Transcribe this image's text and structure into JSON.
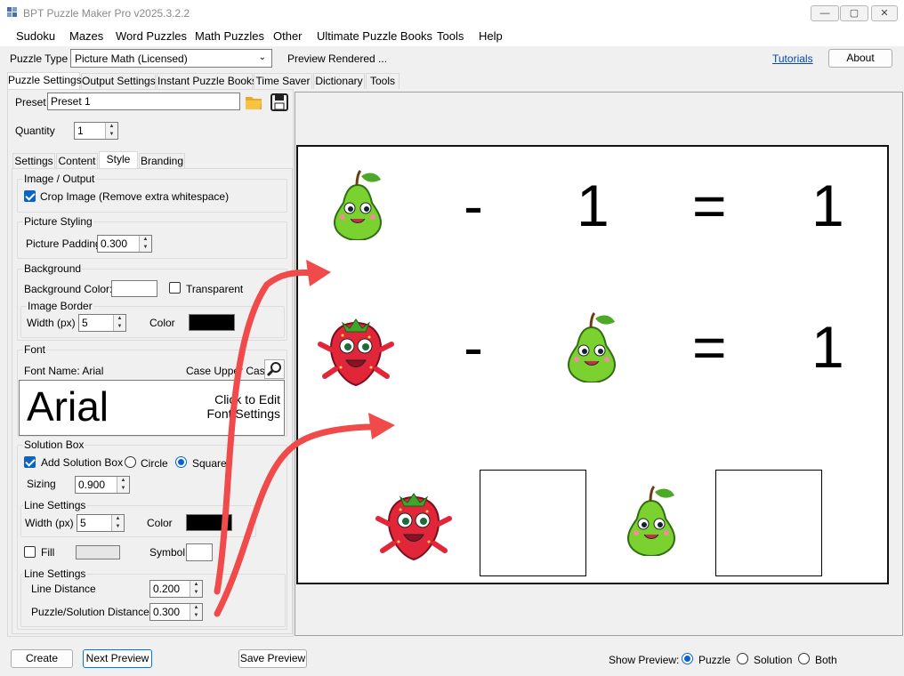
{
  "window": {
    "title": "BPT Puzzle Maker Pro v2025.3.2.2",
    "controls": [
      "—",
      "▢",
      "✕"
    ]
  },
  "menu": [
    "Sudoku",
    "Mazes",
    "Word Puzzles",
    "Math Puzzles",
    "Other",
    "Ultimate Puzzle Books",
    "Tools",
    "Help"
  ],
  "toolbar": {
    "puzzle_type_label": "Puzzle Type",
    "puzzle_type_value": "Picture Math (Licensed)",
    "status": "Preview Rendered ...",
    "tutorials_link": "Tutorials",
    "about_button": "About"
  },
  "main_tabs": [
    "Puzzle Settings",
    "Output Settings",
    "Instant Puzzle Books",
    "Time Saver",
    "Dictionary",
    "Tools"
  ],
  "settings": {
    "preset_label": "Preset",
    "preset_value": "Preset 1",
    "quantity_label": "Quantity",
    "quantity_value": "1",
    "sub_tabs": [
      "Settings",
      "Content",
      "Style",
      "Branding"
    ],
    "image_output": {
      "title": "Image / Output",
      "crop_label": "Crop Image (Remove extra whitespace)"
    },
    "picture_styling": {
      "title": "Picture Styling",
      "padding_label": "Picture Padding",
      "padding_value": "0.300"
    },
    "background": {
      "title": "Background",
      "color_label": "Background Color:",
      "transparent_label": "Transparent",
      "border_title": "Image Border",
      "width_label": "Width (px)",
      "width_value": "5",
      "color_label2": "Color",
      "border_color": "#000000"
    },
    "font": {
      "title": "Font",
      "name_label": "Font Name: Arial",
      "case_label": "Case Upper Case",
      "sample": "Arial",
      "edit_hint_1": "Click to Edit",
      "edit_hint_2": "Font Settings"
    },
    "solution_box": {
      "title": "Solution Box",
      "add_label": "Add Solution Box",
      "circle_label": "Circle",
      "square_label": "Square",
      "sizing_label": "Sizing",
      "sizing_value": "0.900"
    },
    "line_settings": {
      "title": "Line Settings",
      "width_label": "Width (px)",
      "width_value": "5",
      "color_label": "Color",
      "fill_label": "Fill",
      "symbol_label": "Symbol",
      "line_color": "#000000"
    },
    "line_settings2": {
      "title": "Line Settings",
      "distance_label": "Line Distance",
      "distance_value": "0.200",
      "ps_distance_label": "Puzzle/Solution Distance",
      "ps_distance_value": "0.300"
    }
  },
  "preview": {
    "rows": [
      {
        "items": [
          "pear-icon",
          "-",
          "1",
          "=",
          "1"
        ]
      },
      {
        "items": [
          "strawberry-icon",
          "-",
          "pear-icon",
          "=",
          "1"
        ]
      },
      {
        "items": [
          "strawberry-icon",
          "box",
          "pear-icon",
          "box"
        ]
      }
    ],
    "arrow_color": "#f04a4a"
  },
  "bottom": {
    "create_button": "Create",
    "next_preview_button": "Next Preview",
    "save_preview_button": "Save Preview",
    "show_preview_label": "Show Preview:",
    "options": [
      "Puzzle",
      "Solution",
      "Both"
    ],
    "selected": "Puzzle"
  }
}
